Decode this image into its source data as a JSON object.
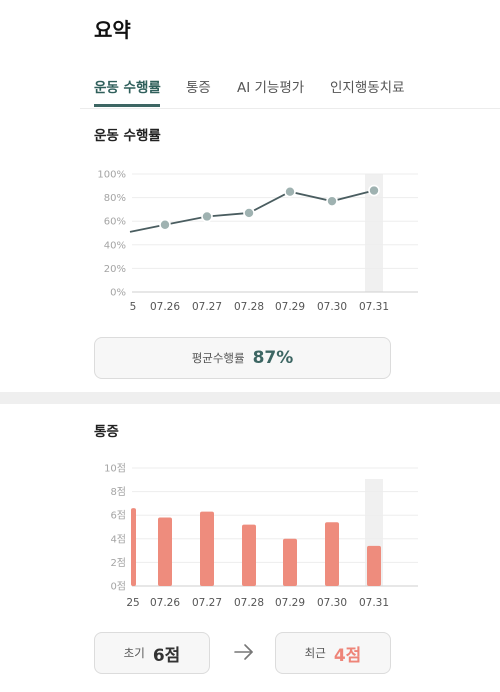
{
  "page": {
    "title": "요약"
  },
  "tabs": [
    {
      "label": "운동 수행률",
      "active": true
    },
    {
      "label": "통증",
      "active": false
    },
    {
      "label": "AI 기능평가",
      "active": false
    },
    {
      "label": "인지행동치료",
      "active": false
    }
  ],
  "exercise": {
    "section_title": "운동 수행률",
    "average_label": "평균수행률",
    "average_value": "87%"
  },
  "pain": {
    "section_title": "통증",
    "initial_label": "초기",
    "initial_value": "6점",
    "recent_label": "최근",
    "recent_value": "4점"
  },
  "colors": {
    "accent": "#3d6663",
    "line": "#4a5d60",
    "point": "#9fb2b1",
    "bar": "#ee8c7d",
    "highlight": "#f0f0f0",
    "recent_value": "#ee8478"
  },
  "chart_data": [
    {
      "type": "line",
      "categories": [
        "5",
        "07.26",
        "07.27",
        "07.28",
        "07.29",
        "07.30",
        "07.31"
      ],
      "values": [
        51,
        57,
        64,
        67,
        85,
        77,
        86
      ],
      "y_ticks": [
        "100%",
        "80%",
        "60%",
        "40%",
        "20%",
        "0%"
      ],
      "ylim": [
        0,
        100
      ],
      "highlight_category": "07.31",
      "grid": true
    },
    {
      "type": "bar",
      "categories": [
        "25",
        "07.26",
        "07.27",
        "07.28",
        "07.29",
        "07.30",
        "07.31"
      ],
      "values": [
        6.6,
        5.8,
        6.3,
        5.2,
        4.0,
        5.4,
        3.4
      ],
      "y_ticks": [
        "10점",
        "8점",
        "6점",
        "4점",
        "2점",
        "0점"
      ],
      "ylim": [
        0,
        10
      ],
      "highlight_category": "07.31",
      "grid": true
    }
  ]
}
